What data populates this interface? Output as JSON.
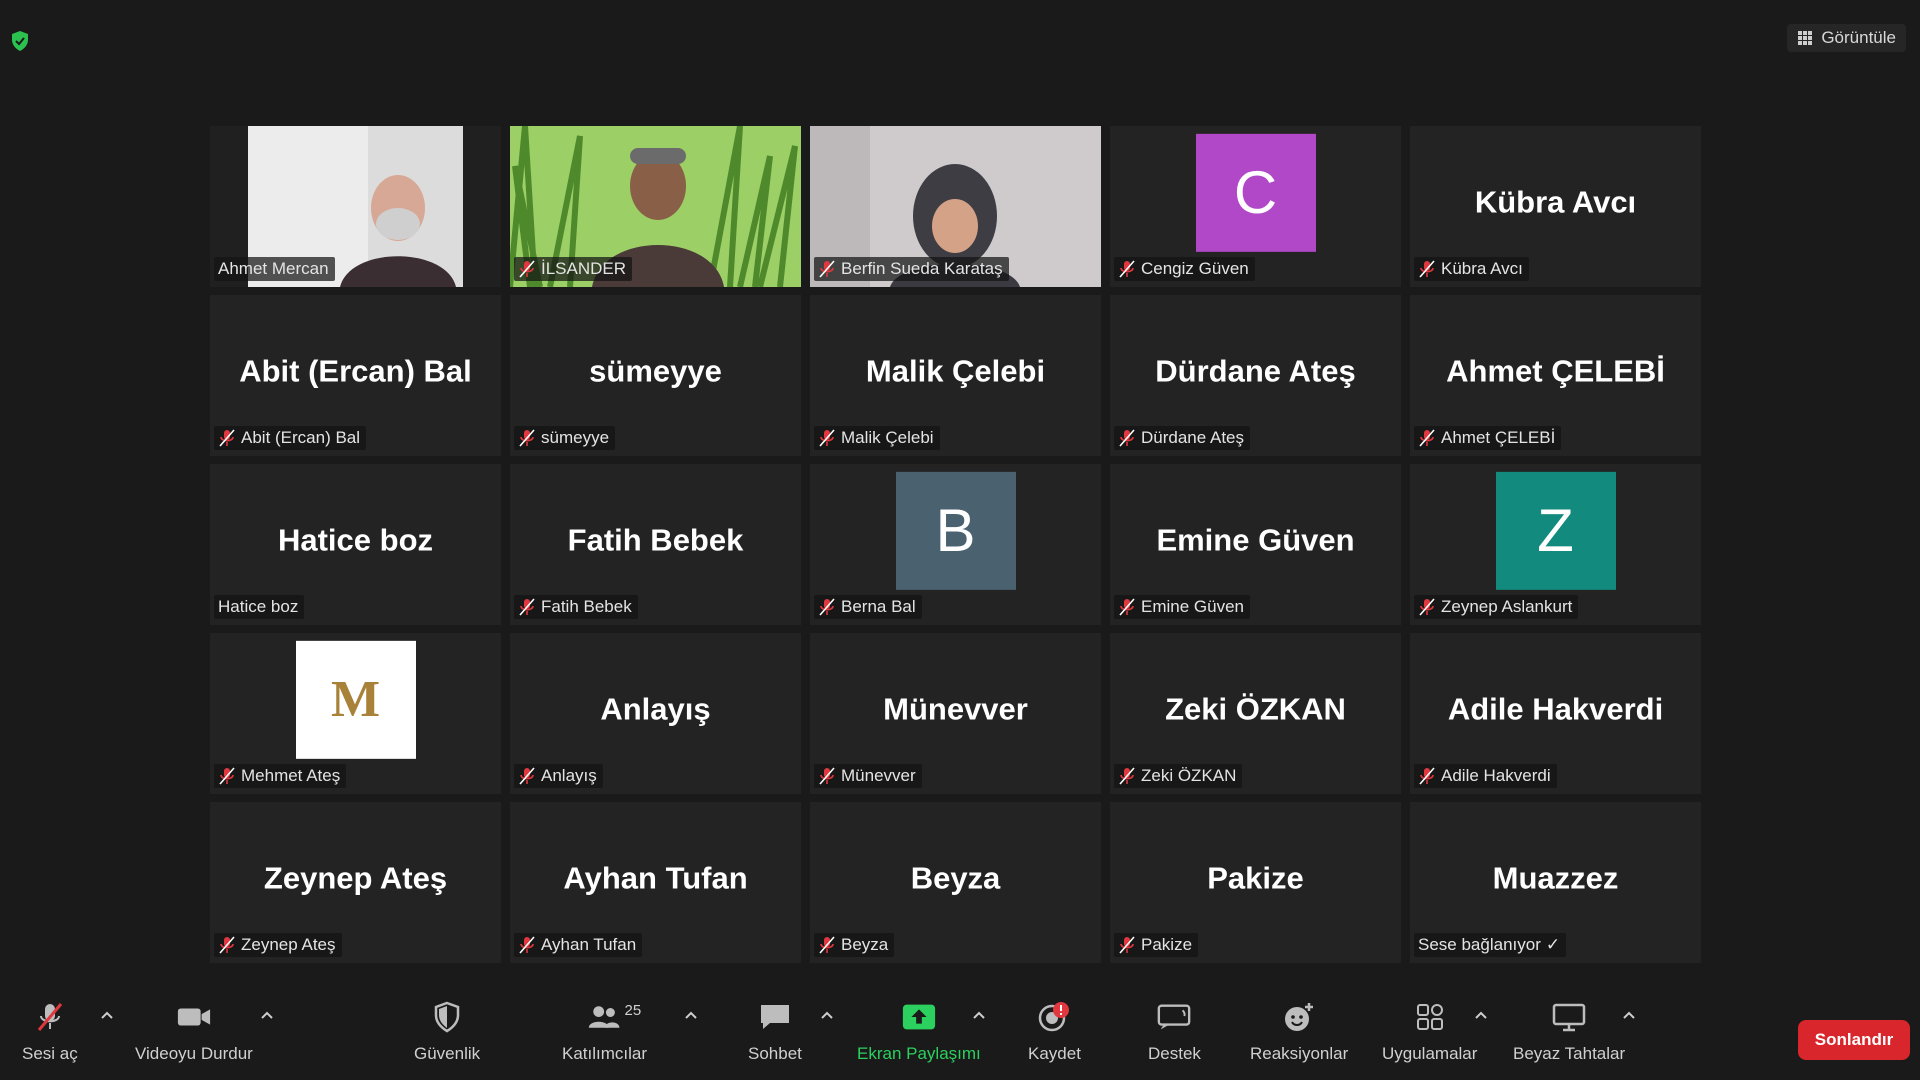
{
  "top_bar": {
    "view_label": "Görüntüle"
  },
  "tiles": [
    {
      "type": "video",
      "label": "Ahmet Mercan",
      "muted": false,
      "active": true,
      "scene": "office"
    },
    {
      "type": "video",
      "label": "İLSANDER",
      "muted": true,
      "scene": "grass"
    },
    {
      "type": "video",
      "label": "Berfin Sueda Karataş",
      "muted": true,
      "scene": "room"
    },
    {
      "type": "avatar",
      "label": "Cengiz Güven",
      "avatar": "C",
      "avatar_color": "#b048c8",
      "muted": true
    },
    {
      "type": "name",
      "label": "Kübra Avcı",
      "display": "Kübra Avcı",
      "muted": true
    },
    {
      "type": "name",
      "label": "Abit (Ercan) Bal",
      "display": "Abit (Ercan) Bal",
      "muted": true
    },
    {
      "type": "name",
      "label": "sümeyye",
      "display": "sümeyye",
      "muted": true
    },
    {
      "type": "name",
      "label": "Malik Çelebi",
      "display": "Malik Çelebi",
      "muted": true
    },
    {
      "type": "name",
      "label": "Dürdane Ateş",
      "display": "Dürdane Ateş",
      "muted": true
    },
    {
      "type": "name",
      "label": "Ahmet ÇELEBİ",
      "display": "Ahmet ÇELEBİ",
      "muted": true
    },
    {
      "type": "name",
      "label": "Hatice boz",
      "display": "Hatice boz",
      "muted": false
    },
    {
      "type": "name",
      "label": "Fatih Bebek",
      "display": "Fatih Bebek",
      "muted": true
    },
    {
      "type": "avatar",
      "label": "Berna Bal",
      "avatar": "B",
      "avatar_color": "#4a6270",
      "muted": true
    },
    {
      "type": "name",
      "label": "Emine Güven",
      "display": "Emine Güven",
      "muted": true
    },
    {
      "type": "avatar",
      "label": "Zeynep Aslankurt",
      "avatar": "Z",
      "avatar_color": "#138a7e",
      "muted": true
    },
    {
      "type": "logo",
      "label": "Mehmet Ateş",
      "avatar": "M",
      "muted": true
    },
    {
      "type": "name",
      "label": "Anlayış",
      "display": "Anlayış",
      "muted": true
    },
    {
      "type": "name",
      "label": "Münevver",
      "display": "Münevver",
      "muted": true
    },
    {
      "type": "name",
      "label": "Zeki ÖZKAN",
      "display": "Zeki ÖZKAN",
      "muted": true
    },
    {
      "type": "name",
      "label": "Adile Hakverdi",
      "display": "Adile Hakverdi",
      "muted": true
    },
    {
      "type": "name",
      "label": "Zeynep Ateş",
      "display": "Zeynep Ateş",
      "muted": true
    },
    {
      "type": "name",
      "label": "Ayhan Tufan",
      "display": "Ayhan Tufan",
      "muted": true
    },
    {
      "type": "name",
      "label": "Beyza",
      "display": "Beyza",
      "muted": true
    },
    {
      "type": "name",
      "label": "Pakize",
      "display": "Pakize",
      "muted": true
    },
    {
      "type": "name",
      "label": "Muazzez",
      "display": "Muazzez",
      "muted": false,
      "connecting": true
    }
  ],
  "toolbar": {
    "unmute": "Sesi aç",
    "stop_video": "Videoyu Durdur",
    "security": "Güvenlik",
    "participants": "Katılımcılar",
    "participants_count": "25",
    "chat": "Sohbet",
    "share_screen": "Ekran Paylaşımı",
    "record": "Kaydet",
    "support": "Destek",
    "reactions": "Reaksiyonlar",
    "apps": "Uygulamalar",
    "whiteboards": "Beyaz Tahtalar",
    "end": "Sonlandır"
  },
  "colors": {
    "accent_green": "#2bd05e",
    "end_red": "#d9262c",
    "active_border": "#e3e35a",
    "mute_red": "#e0383e"
  },
  "icons": [
    "shield-icon",
    "grid-icon",
    "mic-muted-icon",
    "video-camera-icon",
    "security-shield-icon",
    "participants-icon",
    "chat-icon",
    "share-screen-icon",
    "record-icon",
    "support-icon",
    "reactions-icon",
    "apps-icon",
    "whiteboard-icon",
    "chevron-up-icon"
  ]
}
